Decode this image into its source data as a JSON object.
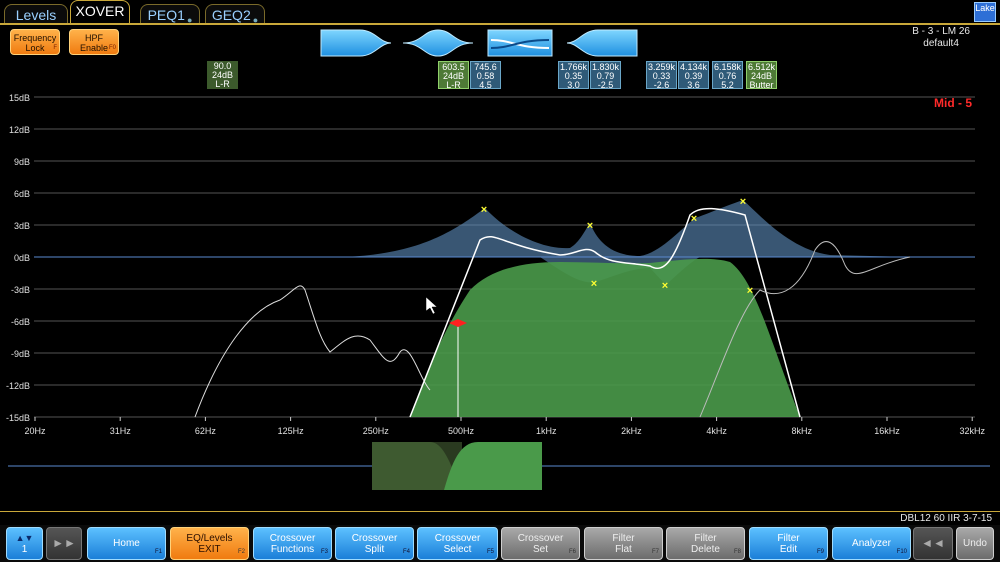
{
  "tabs": [
    {
      "label": "Levels",
      "active": false
    },
    {
      "label": "XOVER",
      "active": true
    },
    {
      "label": "PEQ1",
      "active": false
    },
    {
      "label": "GEQ2",
      "active": false
    }
  ],
  "brand": "Lake",
  "top_buttons": {
    "frequency_lock": {
      "line1": "Frequency",
      "line2": "Lock",
      "fkey": "F"
    },
    "hpf_enable": {
      "line1": "HPF",
      "line2": "Enable",
      "fkey": "F0"
    }
  },
  "device": {
    "name": "B - 3 - LM 26",
    "preset": "default4"
  },
  "param_boxes": [
    {
      "lines": [
        "90.0",
        "24dB",
        "L-R"
      ],
      "style": "dg"
    },
    {
      "lines": [
        "603.5",
        "24dB",
        "L-R"
      ],
      "style": "g"
    },
    {
      "lines": [
        "745.6",
        "0.58",
        "4.5"
      ],
      "style": "b"
    },
    {
      "lines": [
        "1.766k",
        "0.35",
        "3.0"
      ],
      "style": "b"
    },
    {
      "lines": [
        "1.830k",
        "0.79",
        "-2.5"
      ],
      "style": "b"
    },
    {
      "lines": [
        "3.259k",
        "0.33",
        "-2.6"
      ],
      "style": "b"
    },
    {
      "lines": [
        "4.134k",
        "0.39",
        "3.6"
      ],
      "style": "b"
    },
    {
      "lines": [
        "6.158k",
        "0.76",
        "5.2"
      ],
      "style": "b"
    },
    {
      "lines": [
        "6.512k",
        "24dB",
        "Butter"
      ],
      "style": "g"
    }
  ],
  "band_label": "Mid - 5",
  "graph": {
    "y_ticks": [
      "15dB",
      "12dB",
      "9dB",
      "6dB",
      "3dB",
      "0dB",
      "-3dB",
      "-6dB",
      "-9dB",
      "-12dB",
      "-15dB"
    ],
    "x_ticks": [
      "20Hz",
      "31Hz",
      "62Hz",
      "125Hz",
      "250Hz",
      "500Hz",
      "1kHz",
      "2kHz",
      "4kHz",
      "8kHz",
      "16kHz",
      "32kHz"
    ],
    "colors": {
      "grid": "#555555",
      "passband": "#4a9a4a",
      "peq": "#5f8fbf",
      "curve": "#ffffff",
      "marker": "#ffff33",
      "xover_marker": "#ff2020",
      "baseline": "#5a8ad0"
    }
  },
  "status_text": "DBL12 60 IIR 3-7-15",
  "bottom_buttons": [
    {
      "label1": "",
      "label2": "1",
      "style": "blue",
      "fkey": "",
      "icon": "up-down-arrows-icon"
    },
    {
      "label1": "",
      "label2": "",
      "style": "dark",
      "fkey": "",
      "icon": "fast-forward-icon"
    },
    {
      "label1": "Home",
      "label2": "",
      "style": "blue",
      "fkey": "F1"
    },
    {
      "label1": "EQ/Levels",
      "label2": "EXIT",
      "style": "orange",
      "fkey": "F2"
    },
    {
      "label1": "Crossover",
      "label2": "Functions",
      "style": "blue",
      "fkey": "F3"
    },
    {
      "label1": "Crossover",
      "label2": "Split",
      "style": "blue",
      "fkey": "F4"
    },
    {
      "label1": "Crossover",
      "label2": "Select",
      "style": "blue",
      "fkey": "F5"
    },
    {
      "label1": "Crossover",
      "label2": "Set",
      "style": "gray",
      "fkey": "F6"
    },
    {
      "label1": "Filter",
      "label2": "Flat",
      "style": "gray",
      "fkey": "F7"
    },
    {
      "label1": "Filter",
      "label2": "Delete",
      "style": "gray",
      "fkey": "F8"
    },
    {
      "label1": "Filter",
      "label2": "Edit",
      "style": "blue",
      "fkey": "F9"
    },
    {
      "label1": "Analyzer",
      "label2": "",
      "style": "blue",
      "fkey": "F10"
    },
    {
      "label1": "",
      "label2": "",
      "style": "dark",
      "fkey": "",
      "icon": "rewind-icon"
    },
    {
      "label1": "Undo",
      "label2": "",
      "style": "gray",
      "fkey": ""
    }
  ]
}
